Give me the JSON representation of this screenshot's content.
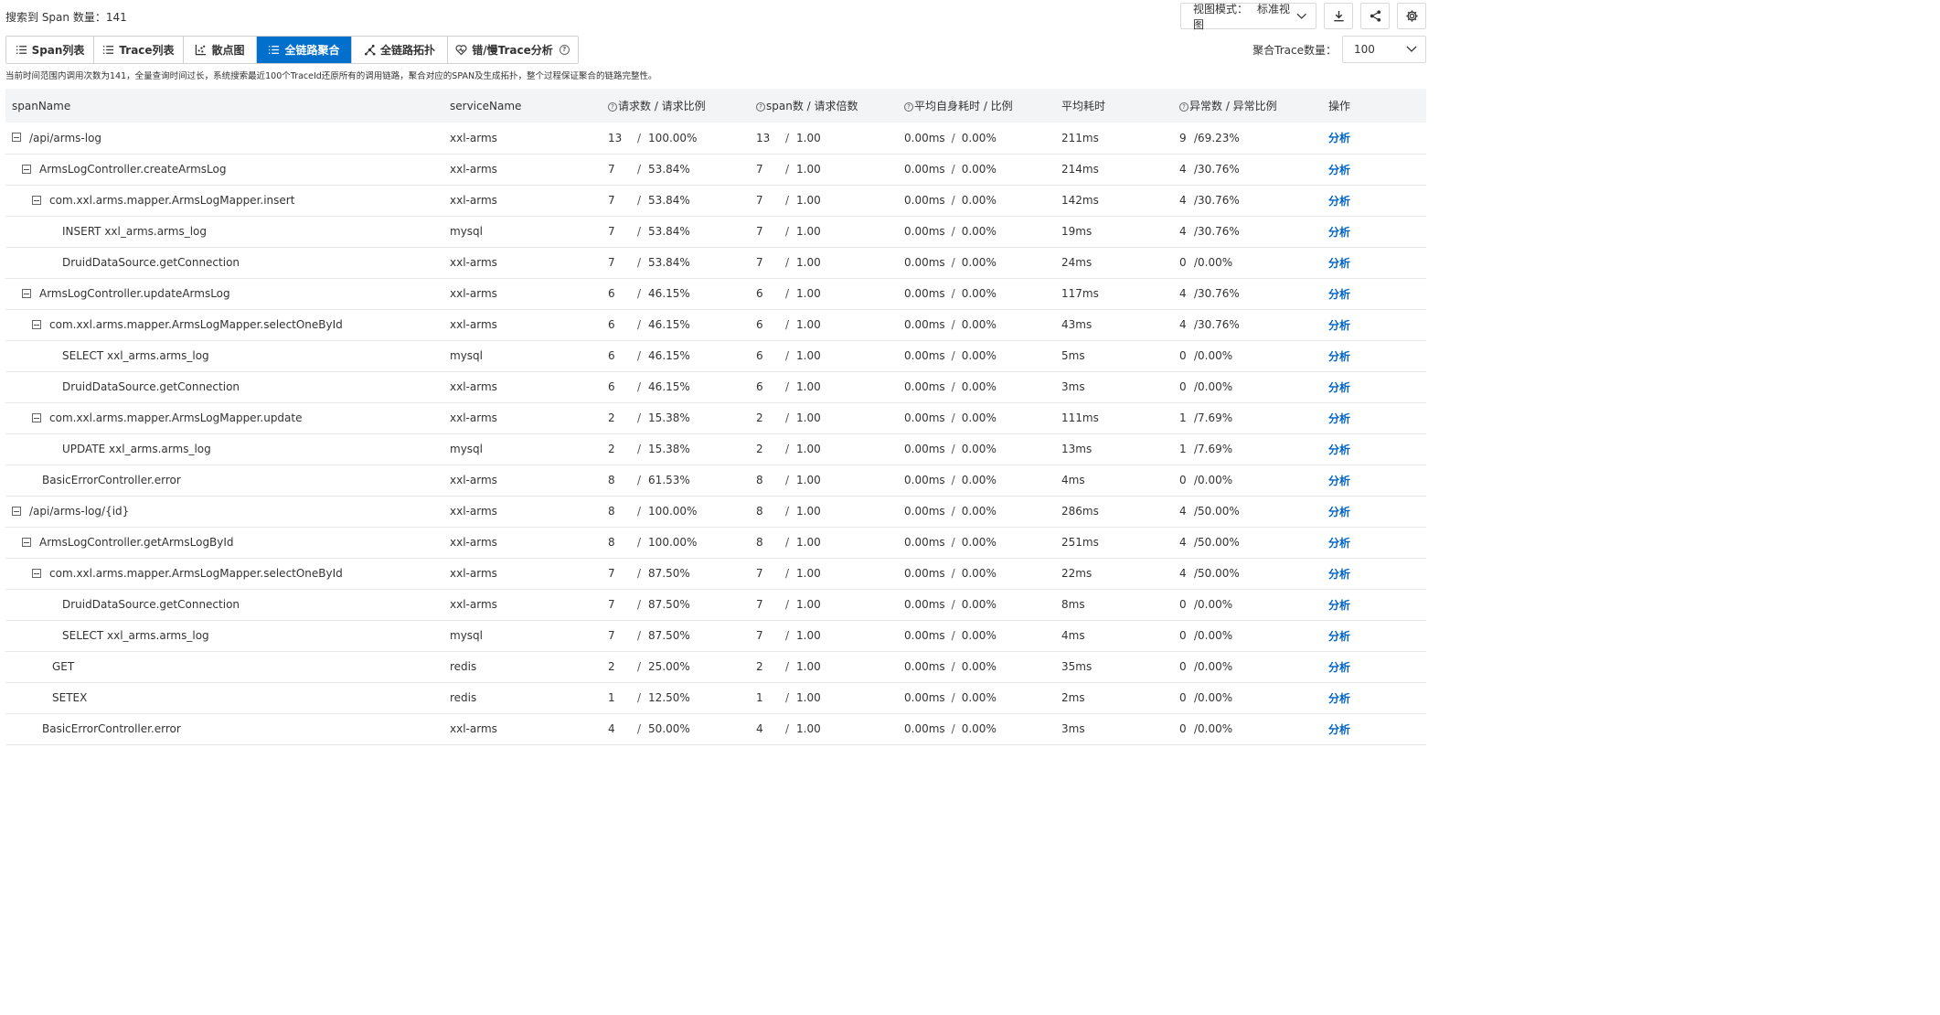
{
  "summary": "搜索到 Span 数量：141",
  "view_mode": {
    "label": "视图模式：",
    "value": "标准视图"
  },
  "tabs": [
    {
      "label": "Span列表",
      "icon": "list-icon",
      "active": false
    },
    {
      "label": "Trace列表",
      "icon": "list-icon",
      "active": false
    },
    {
      "label": "散点图",
      "icon": "scatter-icon",
      "active": false
    },
    {
      "label": "全链路聚合",
      "icon": "list-icon",
      "active": true
    },
    {
      "label": "全链路拓扑",
      "icon": "topology-icon",
      "active": false
    },
    {
      "label": "错/慢Trace分析",
      "icon": "heart-icon",
      "active": false
    }
  ],
  "agg": {
    "label": "聚合Trace数量：",
    "value": "100"
  },
  "notice": "当前时间范围内调用次数为141，全量查询时间过长，系统搜索最近100个TraceId还原所有的调用链路，聚合对应的SPAN及生成拓扑，整个过程保证聚合的链路完整性。",
  "columns": [
    "spanName",
    "serviceName",
    "请求数 / 请求比例",
    "span数 / 请求倍数",
    "平均自身耗时 / 比例",
    "平均耗时",
    "异常数 / 异常比例",
    "操作"
  ],
  "action_label": "分析",
  "rows": [
    {
      "level": 0,
      "expand": true,
      "name": "/api/arms-log",
      "service": "xxl-arms",
      "req": "13",
      "req_ratio": "100.00%",
      "span": "13",
      "span_mult": "1.00",
      "self_time": "0.00ms",
      "self_ratio": "0.00%",
      "avg": "211ms",
      "err": "9",
      "err_ratio": "/69.23%"
    },
    {
      "level": 1,
      "expand": true,
      "name": "ArmsLogController.createArmsLog",
      "service": "xxl-arms",
      "req": "7",
      "req_ratio": "53.84%",
      "span": "7",
      "span_mult": "1.00",
      "self_time": "0.00ms",
      "self_ratio": "0.00%",
      "avg": "214ms",
      "err": "4",
      "err_ratio": "/30.76%"
    },
    {
      "level": 2,
      "expand": true,
      "name": "com.xxl.arms.mapper.ArmsLogMapper.insert",
      "service": "xxl-arms",
      "req": "7",
      "req_ratio": "53.84%",
      "span": "7",
      "span_mult": "1.00",
      "self_time": "0.00ms",
      "self_ratio": "0.00%",
      "avg": "142ms",
      "err": "4",
      "err_ratio": "/30.76%"
    },
    {
      "level": 3,
      "expand": false,
      "name": "INSERT xxl_arms.arms_log",
      "service": "mysql",
      "req": "7",
      "req_ratio": "53.84%",
      "span": "7",
      "span_mult": "1.00",
      "self_time": "0.00ms",
      "self_ratio": "0.00%",
      "avg": "19ms",
      "err": "4",
      "err_ratio": "/30.76%"
    },
    {
      "level": 3,
      "expand": false,
      "name": "DruidDataSource.getConnection",
      "service": "xxl-arms",
      "req": "7",
      "req_ratio": "53.84%",
      "span": "7",
      "span_mult": "1.00",
      "self_time": "0.00ms",
      "self_ratio": "0.00%",
      "avg": "24ms",
      "err": "0",
      "err_ratio": "/0.00%"
    },
    {
      "level": 1,
      "expand": true,
      "name": "ArmsLogController.updateArmsLog",
      "service": "xxl-arms",
      "req": "6",
      "req_ratio": "46.15%",
      "span": "6",
      "span_mult": "1.00",
      "self_time": "0.00ms",
      "self_ratio": "0.00%",
      "avg": "117ms",
      "err": "4",
      "err_ratio": "/30.76%"
    },
    {
      "level": 2,
      "expand": true,
      "name": "com.xxl.arms.mapper.ArmsLogMapper.selectOneById",
      "service": "xxl-arms",
      "req": "6",
      "req_ratio": "46.15%",
      "span": "6",
      "span_mult": "1.00",
      "self_time": "0.00ms",
      "self_ratio": "0.00%",
      "avg": "43ms",
      "err": "4",
      "err_ratio": "/30.76%"
    },
    {
      "level": 3,
      "expand": false,
      "name": "SELECT xxl_arms.arms_log",
      "service": "mysql",
      "req": "6",
      "req_ratio": "46.15%",
      "span": "6",
      "span_mult": "1.00",
      "self_time": "0.00ms",
      "self_ratio": "0.00%",
      "avg": "5ms",
      "err": "0",
      "err_ratio": "/0.00%"
    },
    {
      "level": 3,
      "expand": false,
      "name": "DruidDataSource.getConnection",
      "service": "xxl-arms",
      "req": "6",
      "req_ratio": "46.15%",
      "span": "6",
      "span_mult": "1.00",
      "self_time": "0.00ms",
      "self_ratio": "0.00%",
      "avg": "3ms",
      "err": "0",
      "err_ratio": "/0.00%"
    },
    {
      "level": 2,
      "expand": true,
      "name": "com.xxl.arms.mapper.ArmsLogMapper.update",
      "service": "xxl-arms",
      "req": "2",
      "req_ratio": "15.38%",
      "span": "2",
      "span_mult": "1.00",
      "self_time": "0.00ms",
      "self_ratio": "0.00%",
      "avg": "111ms",
      "err": "1",
      "err_ratio": "/7.69%"
    },
    {
      "level": 3,
      "expand": false,
      "name": "UPDATE xxl_arms.arms_log",
      "service": "mysql",
      "req": "2",
      "req_ratio": "15.38%",
      "span": "2",
      "span_mult": "1.00",
      "self_time": "0.00ms",
      "self_ratio": "0.00%",
      "avg": "13ms",
      "err": "1",
      "err_ratio": "/7.69%"
    },
    {
      "level": 1.5,
      "expand": false,
      "name": "BasicErrorController.error",
      "service": "xxl-arms",
      "req": "8",
      "req_ratio": "61.53%",
      "span": "8",
      "span_mult": "1.00",
      "self_time": "0.00ms",
      "self_ratio": "0.00%",
      "avg": "4ms",
      "err": "0",
      "err_ratio": "/0.00%"
    },
    {
      "level": 0,
      "expand": true,
      "name": "/api/arms-log/{id}",
      "service": "xxl-arms",
      "req": "8",
      "req_ratio": "100.00%",
      "span": "8",
      "span_mult": "1.00",
      "self_time": "0.00ms",
      "self_ratio": "0.00%",
      "avg": "286ms",
      "err": "4",
      "err_ratio": "/50.00%"
    },
    {
      "level": 1,
      "expand": true,
      "name": "ArmsLogController.getArmsLogById",
      "service": "xxl-arms",
      "req": "8",
      "req_ratio": "100.00%",
      "span": "8",
      "span_mult": "1.00",
      "self_time": "0.00ms",
      "self_ratio": "0.00%",
      "avg": "251ms",
      "err": "4",
      "err_ratio": "/50.00%"
    },
    {
      "level": 2,
      "expand": true,
      "name": "com.xxl.arms.mapper.ArmsLogMapper.selectOneById",
      "service": "xxl-arms",
      "req": "7",
      "req_ratio": "87.50%",
      "span": "7",
      "span_mult": "1.00",
      "self_time": "0.00ms",
      "self_ratio": "0.00%",
      "avg": "22ms",
      "err": "4",
      "err_ratio": "/50.00%"
    },
    {
      "level": 3,
      "expand": false,
      "name": "DruidDataSource.getConnection",
      "service": "xxl-arms",
      "req": "7",
      "req_ratio": "87.50%",
      "span": "7",
      "span_mult": "1.00",
      "self_time": "0.00ms",
      "self_ratio": "0.00%",
      "avg": "8ms",
      "err": "0",
      "err_ratio": "/0.00%"
    },
    {
      "level": 3,
      "expand": false,
      "name": "SELECT xxl_arms.arms_log",
      "service": "mysql",
      "req": "7",
      "req_ratio": "87.50%",
      "span": "7",
      "span_mult": "1.00",
      "self_time": "0.00ms",
      "self_ratio": "0.00%",
      "avg": "4ms",
      "err": "0",
      "err_ratio": "/0.00%"
    },
    {
      "level": 2.5,
      "expand": false,
      "name": "GET",
      "service": "redis",
      "req": "2",
      "req_ratio": "25.00%",
      "span": "2",
      "span_mult": "1.00",
      "self_time": "0.00ms",
      "self_ratio": "0.00%",
      "avg": "35ms",
      "err": "0",
      "err_ratio": "/0.00%"
    },
    {
      "level": 2.5,
      "expand": false,
      "name": "SETEX",
      "service": "redis",
      "req": "1",
      "req_ratio": "12.50%",
      "span": "1",
      "span_mult": "1.00",
      "self_time": "0.00ms",
      "self_ratio": "0.00%",
      "avg": "2ms",
      "err": "0",
      "err_ratio": "/0.00%"
    },
    {
      "level": 1.5,
      "expand": false,
      "name": "BasicErrorController.error",
      "service": "xxl-arms",
      "req": "4",
      "req_ratio": "50.00%",
      "span": "4",
      "span_mult": "1.00",
      "self_time": "0.00ms",
      "self_ratio": "0.00%",
      "avg": "3ms",
      "err": "0",
      "err_ratio": "/0.00%"
    }
  ]
}
